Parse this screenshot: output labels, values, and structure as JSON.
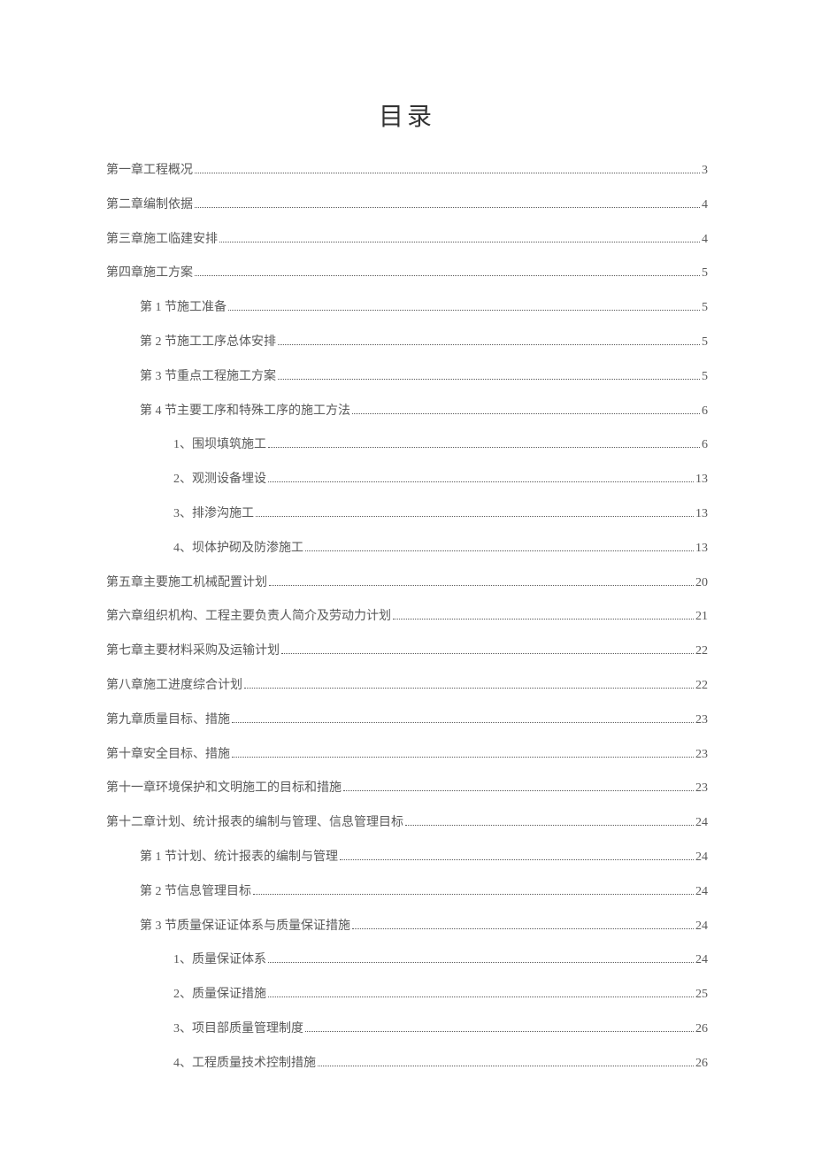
{
  "title": "目录",
  "toc": [
    {
      "level": 0,
      "label": "第一章工程概况",
      "page": "3"
    },
    {
      "level": 0,
      "label": "第二章编制依据",
      "page": "4"
    },
    {
      "level": 0,
      "label": "第三章施工临建安排",
      "page": "4"
    },
    {
      "level": 0,
      "label": "第四章施工方案",
      "page": "5"
    },
    {
      "level": 1,
      "label": "第 1 节施工准备",
      "page": "5"
    },
    {
      "level": 1,
      "label": "第 2 节施工工序总体安排",
      "page": "5"
    },
    {
      "level": 1,
      "label": "第 3 节重点工程施工方案",
      "page": "5"
    },
    {
      "level": 1,
      "label": "第 4 节主要工序和特殊工序的施工方法",
      "page": "6"
    },
    {
      "level": 2,
      "label": "1、围坝填筑施工",
      "page": "6"
    },
    {
      "level": 2,
      "label": "2、观测设备埋设",
      "page": "13"
    },
    {
      "level": 2,
      "label": "3、排渗沟施工",
      "page": "13"
    },
    {
      "level": 2,
      "label": "4、坝体护砌及防渗施工",
      "page": "13"
    },
    {
      "level": 0,
      "label": "第五章主要施工机械配置计划",
      "page": "20"
    },
    {
      "level": 0,
      "label": "第六章组织机构、工程主要负责人简介及劳动力计划",
      "page": "21"
    },
    {
      "level": 0,
      "label": "第七章主要材料采购及运输计划",
      "page": "22"
    },
    {
      "level": 0,
      "label": "第八章施工进度综合计划",
      "page": "22"
    },
    {
      "level": 0,
      "label": "第九章质量目标、措施",
      "page": "23"
    },
    {
      "level": 0,
      "label": "第十章安全目标、措施",
      "page": "23"
    },
    {
      "level": 0,
      "label": "第十一章环境保护和文明施工的目标和措施",
      "page": "23"
    },
    {
      "level": 0,
      "label": "第十二章计划、统计报表的编制与管理、信息管理目标",
      "page": "24"
    },
    {
      "level": 1,
      "label": "第 1 节计划、统计报表的编制与管理",
      "page": "24"
    },
    {
      "level": 1,
      "label": "第 2 节信息管理目标",
      "page": "24"
    },
    {
      "level": 1,
      "label": "第 3 节质量保证证体系与质量保证措施",
      "page": "24"
    },
    {
      "level": 2,
      "label": "1、质量保证体系",
      "page": "24"
    },
    {
      "level": 2,
      "label": "2、质量保证措施",
      "page": "25"
    },
    {
      "level": 2,
      "label": "3、项目部质量管理制度",
      "page": "26"
    },
    {
      "level": 2,
      "label": "4、工程质量技术控制措施",
      "page": "26"
    }
  ]
}
